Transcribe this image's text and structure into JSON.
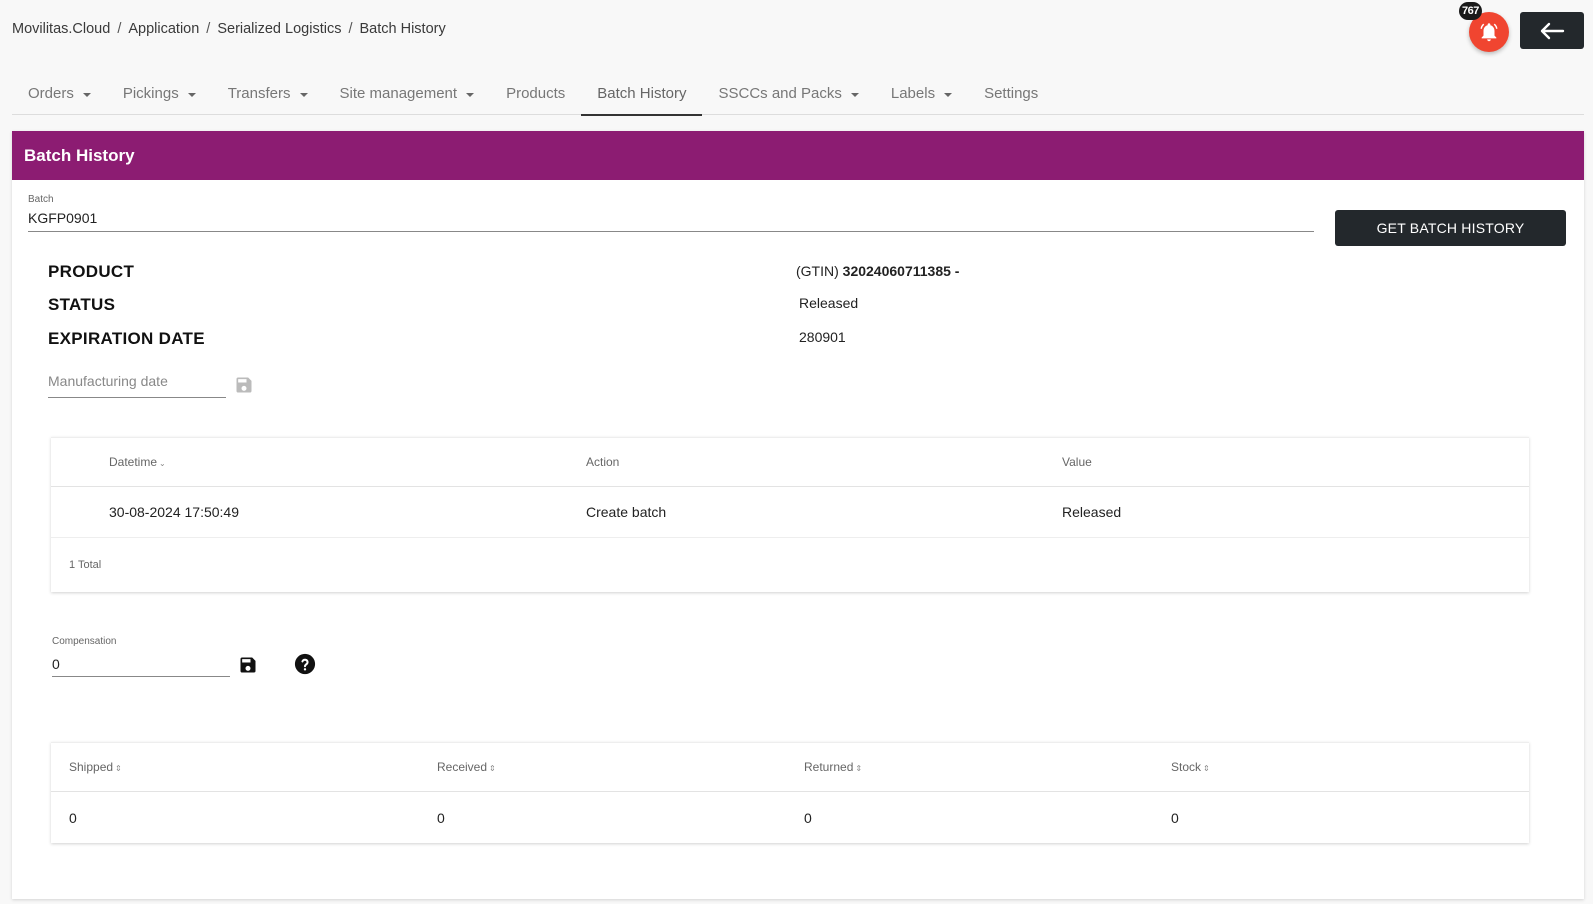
{
  "breadcrumb": {
    "items": [
      "Movilitas.Cloud",
      "Application",
      "Serialized Logistics",
      "Batch History"
    ],
    "separator": "/"
  },
  "header": {
    "notification_count": "767",
    "notification_color": "#f04530",
    "back_icon": "arrow-left-icon"
  },
  "nav": {
    "tabs": [
      {
        "label": "Orders",
        "dropdown": true
      },
      {
        "label": "Pickings",
        "dropdown": true
      },
      {
        "label": "Transfers",
        "dropdown": true
      },
      {
        "label": "Site management",
        "dropdown": true
      },
      {
        "label": "Products",
        "dropdown": false
      },
      {
        "label": "Batch History",
        "dropdown": false,
        "active": true
      },
      {
        "label": "SSCCs and Packs",
        "dropdown": true
      },
      {
        "label": "Labels",
        "dropdown": true
      },
      {
        "label": "Settings",
        "dropdown": false
      }
    ]
  },
  "card": {
    "title": "Batch History",
    "header_color": "#8c1c72"
  },
  "batch": {
    "label": "Batch",
    "value": "KGFP0901",
    "button_label": "GET BATCH HISTORY"
  },
  "info": {
    "product_label": "PRODUCT",
    "product_prefix": "(GTIN)",
    "product_gtin": "32024060711385",
    "product_suffix": "-",
    "status_label": "STATUS",
    "status_value": "Released",
    "expiration_label": "EXPIRATION DATE",
    "expiration_value": "280901",
    "manufacturing_placeholder": "Manufacturing date"
  },
  "history_table": {
    "columns": [
      "Datetime",
      "Action",
      "Value"
    ],
    "rows": [
      {
        "datetime": "30-08-2024 17:50:49",
        "action": "Create batch",
        "value": "Released"
      }
    ],
    "total": "1 Total"
  },
  "compensation": {
    "label": "Compensation",
    "value": "0"
  },
  "stock_table": {
    "columns": [
      "Shipped",
      "Received",
      "Returned",
      "Stock"
    ],
    "values": [
      "0",
      "0",
      "0",
      "0"
    ]
  }
}
